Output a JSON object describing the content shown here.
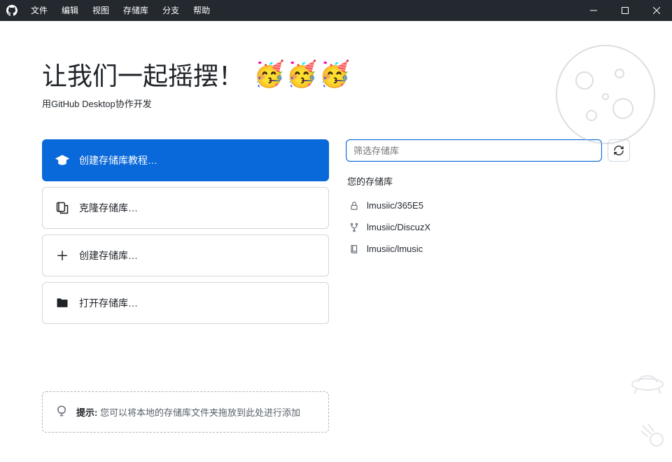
{
  "menu": {
    "file": "文件",
    "edit": "编辑",
    "view": "视图",
    "repository": "存储库",
    "branch": "分支",
    "help": "帮助"
  },
  "hero": {
    "title": "让我们一起摇摆！",
    "subtitle": "用GitHub Desktop协作开发"
  },
  "actions": {
    "tutorial": "创建存储库教程…",
    "clone": "克隆存储库…",
    "create": "创建存储库…",
    "open": "打开存储库…"
  },
  "tip": {
    "label": "提示:",
    "text": "您可以将本地的存储库文件夹拖放到此处进行添加"
  },
  "filter": {
    "placeholder": "筛选存储库"
  },
  "repos": {
    "header": "您的存储库",
    "items": [
      {
        "name": "lmusiic/365E5",
        "icon": "lock"
      },
      {
        "name": "lmusiic/DiscuzX",
        "icon": "fork"
      },
      {
        "name": "lmusiic/lmusic",
        "icon": "repo"
      }
    ]
  }
}
